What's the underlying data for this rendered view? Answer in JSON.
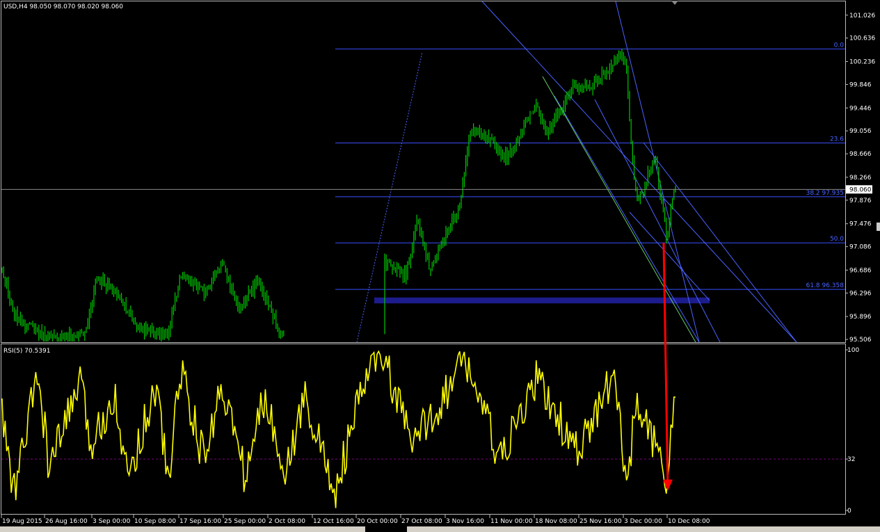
{
  "main_panel": {
    "header": "USD,H4  98.050 98.070 98.020 98.060",
    "symbol": "USD",
    "timeframe": "H4",
    "ohlc": {
      "open": 98.05,
      "high": 98.07,
      "low": 98.02,
      "close": 98.06
    },
    "current_price_label": "98.060",
    "price_ticks": [
      "101.026",
      "100.636",
      "100.236",
      "99.846",
      "99.446",
      "99.056",
      "98.666",
      "98.266",
      "97.876",
      "97.476",
      "97.086",
      "96.686",
      "96.296",
      "95.896",
      "95.506"
    ],
    "fibonacci_levels": [
      {
        "label": "0.0",
        "price": 100.45
      },
      {
        "label": "23.6",
        "price": 98.85
      },
      {
        "label": "38.2 97.935",
        "price": 97.935
      },
      {
        "label": "50.0",
        "price": 97.15
      },
      {
        "label": "61.8 96.358",
        "price": 96.358
      }
    ],
    "support_zone": {
      "from": 96.12,
      "to": 96.22,
      "color": "#1c1c8c"
    }
  },
  "rsi_panel": {
    "header": "RSI(5) 70.5391",
    "name": "RSI(5)",
    "value": 70.5391,
    "ticks": [
      "100",
      "32",
      "0"
    ],
    "reference_level": 32,
    "color": "#ffff00"
  },
  "time_axis": [
    "19 Aug 2015",
    "26 Aug 16:00",
    "3 Sep 00:00",
    "10 Sep 08:00",
    "17 Sep 16:00",
    "25 Sep 00:00",
    "2 Oct 08:00",
    "12 Oct 16:00",
    "20 Oct 00:00",
    "27 Oct 08:00",
    "3 Nov 16:00",
    "11 Nov 00:00",
    "18 Nov 08:00",
    "25 Nov 16:00",
    "3 Dec 00:00",
    "10 Dec 08:00"
  ],
  "colors": {
    "background": "#000000",
    "candles": "#00c800",
    "fib_lines": "#3a4fff",
    "trend_lines": "#4a63ff",
    "green_line": "#66cc66",
    "arrow": "#ff0000",
    "rsi_line": "#ffff00",
    "grid_dashed": "#800080",
    "axis_text": "#ffffff"
  },
  "chart_data": [
    {
      "type": "line",
      "title": "USD,H4",
      "ylim": [
        95.46,
        101.26
      ],
      "price_path_keypoints": [
        {
          "date": "19 Aug 2015",
          "price": 96.7
        },
        {
          "date": "21 Aug 2015",
          "price": 95.9
        },
        {
          "date": "27 Aug 2015",
          "price": 95.5
        },
        {
          "date": "2 Sep 2015",
          "price": 95.6
        },
        {
          "date": "4 Sep 2015",
          "price": 96.6
        },
        {
          "date": "8 Sep 2015",
          "price": 96.2
        },
        {
          "date": "11 Sep 2015",
          "price": 95.7
        },
        {
          "date": "16 Sep 2015",
          "price": 95.6
        },
        {
          "date": "18 Sep 2015",
          "price": 96.6
        },
        {
          "date": "22 Sep 2015",
          "price": 96.3
        },
        {
          "date": "25 Sep 2015",
          "price": 96.8
        },
        {
          "date": "28 Sep 2015",
          "price": 96.0
        },
        {
          "date": "1 Oct 2015",
          "price": 96.5
        },
        {
          "date": "5 Oct 2015",
          "price": 95.6
        },
        {
          "date": "19 Oct 2015",
          "price": 95.6
        },
        {
          "date": "22 Oct 2015",
          "price": 96.9
        },
        {
          "date": "26 Oct 2015",
          "price": 96.6
        },
        {
          "date": "28 Oct 2015",
          "price": 97.6
        },
        {
          "date": "30 Oct 2015",
          "price": 96.7
        },
        {
          "date": "4 Nov 2015",
          "price": 97.8
        },
        {
          "date": "6 Nov 2015",
          "price": 99.1
        },
        {
          "date": "10 Nov 2015",
          "price": 98.8
        },
        {
          "date": "12 Nov 2015",
          "price": 98.6
        },
        {
          "date": "17 Nov 2015",
          "price": 99.5
        },
        {
          "date": "19 Nov 2015",
          "price": 99.0
        },
        {
          "date": "23 Nov 2015",
          "price": 99.8
        },
        {
          "date": "26 Nov 2015",
          "price": 99.8
        },
        {
          "date": "1 Dec 2015",
          "price": 100.3
        },
        {
          "date": "2 Dec 2015",
          "price": 100.2
        },
        {
          "date": "3 Dec 2015",
          "price": 98.7
        },
        {
          "date": "4 Dec 2015",
          "price": 97.8
        },
        {
          "date": "7 Dec 2015",
          "price": 98.6
        },
        {
          "date": "9 Dec 2015",
          "price": 97.2
        },
        {
          "date": "10 Dec 2015",
          "price": 98.06
        }
      ]
    },
    {
      "type": "line",
      "title": "RSI(5)",
      "ylim": [
        0,
        100
      ],
      "reference_line": 32,
      "rsi_keypoints": [
        {
          "date": "19 Aug 2015",
          "rsi": 60
        },
        {
          "date": "21 Aug 2015",
          "rsi": 10
        },
        {
          "date": "25 Aug 2015",
          "rsi": 85
        },
        {
          "date": "27 Aug 2015",
          "rsi": 25
        },
        {
          "date": "1 Sep 2015",
          "rsi": 80
        },
        {
          "date": "3 Sep 2015",
          "rsi": 40
        },
        {
          "date": "7 Sep 2015",
          "rsi": 75
        },
        {
          "date": "9 Sep 2015",
          "rsi": 20
        },
        {
          "date": "14 Sep 2015",
          "rsi": 78
        },
        {
          "date": "16 Sep 2015",
          "rsi": 15
        },
        {
          "date": "18 Sep 2015",
          "rsi": 90
        },
        {
          "date": "22 Sep 2015",
          "rsi": 30
        },
        {
          "date": "25 Sep 2015",
          "rsi": 80
        },
        {
          "date": "29 Sep 2015",
          "rsi": 20
        },
        {
          "date": "2 Oct 2015",
          "rsi": 70
        },
        {
          "date": "6 Oct 2015",
          "rsi": 25
        },
        {
          "date": "9 Oct 2015",
          "rsi": 72
        },
        {
          "date": "14 Oct 2015",
          "rsi": 10
        },
        {
          "date": "19 Oct 2015",
          "rsi": 80
        },
        {
          "date": "22 Oct 2015",
          "rsi": 98
        },
        {
          "date": "27 Oct 2015",
          "rsi": 40
        },
        {
          "date": "2 Nov 2015",
          "rsi": 75
        },
        {
          "date": "5 Nov 2015",
          "rsi": 95
        },
        {
          "date": "11 Nov 2015",
          "rsi": 30
        },
        {
          "date": "17 Nov 2015",
          "rsi": 82
        },
        {
          "date": "24 Nov 2015",
          "rsi": 35
        },
        {
          "date": "30 Nov 2015",
          "rsi": 85
        },
        {
          "date": "2 Dec 2015",
          "rsi": 20
        },
        {
          "date": "4 Dec 2015",
          "rsi": 65
        },
        {
          "date": "8 Dec 2015",
          "rsi": 30
        },
        {
          "date": "9 Dec 2015",
          "rsi": 3
        },
        {
          "date": "10 Dec 2015",
          "rsi": 70.5391
        }
      ]
    }
  ]
}
